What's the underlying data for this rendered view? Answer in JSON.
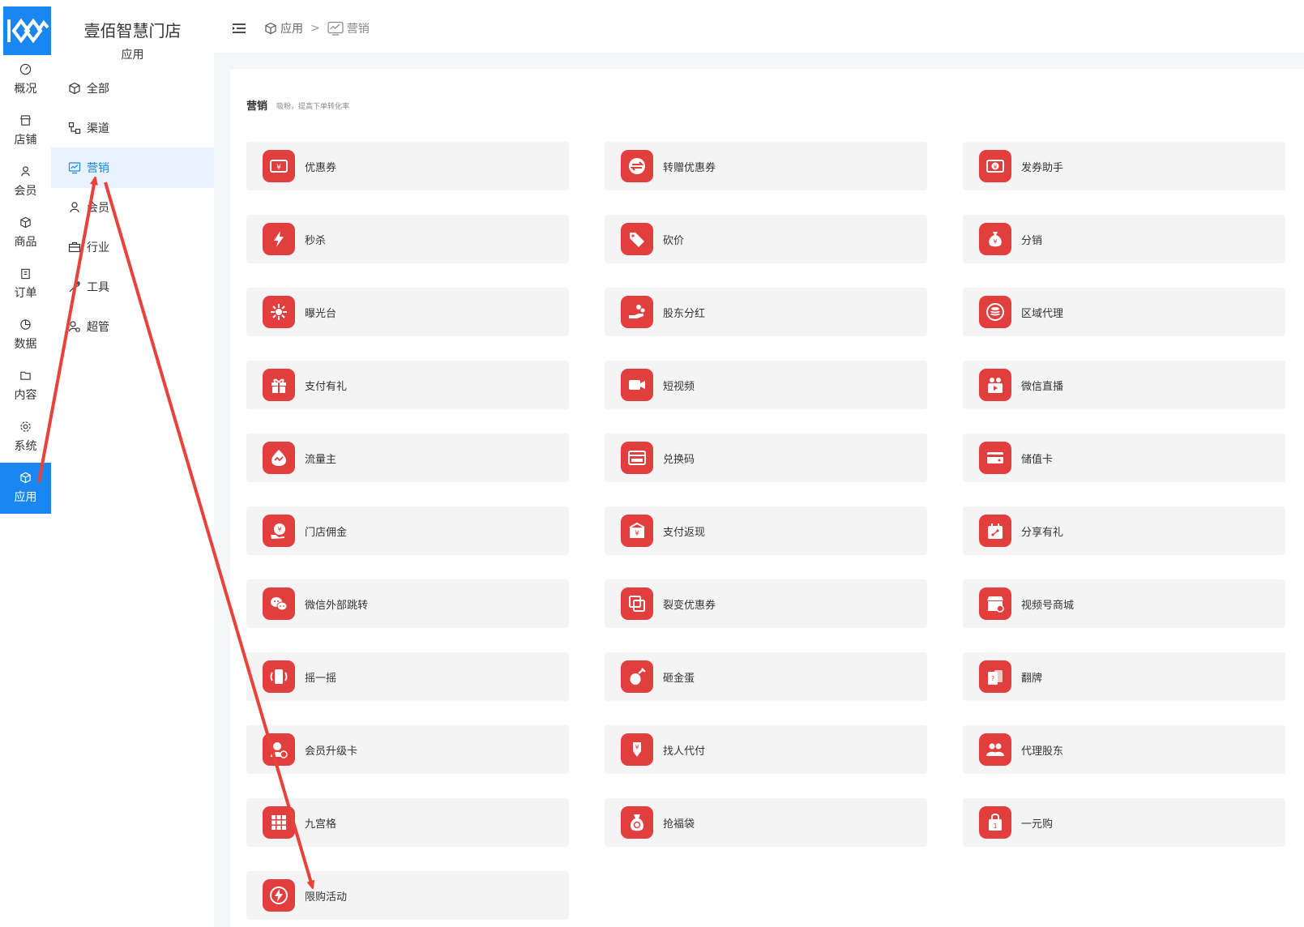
{
  "store_name": "壹佰智慧门店",
  "rail": [
    {
      "label": "概况",
      "icon": "gauge-icon"
    },
    {
      "label": "店铺",
      "icon": "shop-icon"
    },
    {
      "label": "会员",
      "icon": "user-icon"
    },
    {
      "label": "商品",
      "icon": "box-icon"
    },
    {
      "label": "订单",
      "icon": "clipboard-icon"
    },
    {
      "label": "数据",
      "icon": "pie-icon"
    },
    {
      "label": "内容",
      "icon": "folder-icon"
    },
    {
      "label": "系统",
      "icon": "gear-icon"
    },
    {
      "label": "应用",
      "icon": "cube-icon",
      "active": true
    }
  ],
  "submenu": {
    "title": "应用",
    "items": [
      {
        "label": "全部",
        "icon": "cube-icon"
      },
      {
        "label": "渠道",
        "icon": "channel-icon"
      },
      {
        "label": "营销",
        "icon": "chart-monitor-icon",
        "active": true
      },
      {
        "label": "会员",
        "icon": "user-icon"
      },
      {
        "label": "行业",
        "icon": "briefcase-icon"
      },
      {
        "label": "工具",
        "icon": "tool-icon"
      },
      {
        "label": "超管",
        "icon": "admin-icon"
      }
    ]
  },
  "breadcrumb": [
    {
      "label": "应用",
      "icon": "cube-icon"
    },
    {
      "label": "营销",
      "icon": "chart-monitor-icon"
    }
  ],
  "breadcrumb_separator": ">",
  "section": {
    "title": "营销",
    "desc": "吸粉，提高下单转化率"
  },
  "accent_color": "#1a86f0",
  "card_icon_color": "#e23e3e",
  "cards": [
    {
      "label": "优惠券",
      "icon": "coupon-icon"
    },
    {
      "label": "转赠优惠券",
      "icon": "transfer-icon"
    },
    {
      "label": "发券助手",
      "icon": "coupon-assistant-icon"
    },
    {
      "label": "秒杀",
      "icon": "lightning-icon"
    },
    {
      "label": "砍价",
      "icon": "price-tag-icon"
    },
    {
      "label": "分销",
      "icon": "money-bag-icon"
    },
    {
      "label": "曝光台",
      "icon": "sparkle-icon"
    },
    {
      "label": "股东分红",
      "icon": "hand-coins-icon"
    },
    {
      "label": "区域代理",
      "icon": "coins-stack-icon"
    },
    {
      "label": "支付有礼",
      "icon": "gift-icon"
    },
    {
      "label": "短视频",
      "icon": "video-camera-icon"
    },
    {
      "label": "微信直播",
      "icon": "live-icon"
    },
    {
      "label": "流量主",
      "icon": "traffic-icon"
    },
    {
      "label": "兑换码",
      "icon": "redeem-code-icon"
    },
    {
      "label": "储值卡",
      "icon": "card-icon"
    },
    {
      "label": "门店佣金",
      "icon": "commission-icon"
    },
    {
      "label": "支付返现",
      "icon": "cashback-icon"
    },
    {
      "label": "分享有礼",
      "icon": "share-gift-icon"
    },
    {
      "label": "微信外部跳转",
      "icon": "wechat-icon"
    },
    {
      "label": "裂变优惠券",
      "icon": "fission-coupon-icon"
    },
    {
      "label": "视频号商城",
      "icon": "video-shop-icon"
    },
    {
      "label": "摇一摇",
      "icon": "shake-icon"
    },
    {
      "label": "砸金蛋",
      "icon": "egg-hammer-icon"
    },
    {
      "label": "翻牌",
      "icon": "flip-card-icon"
    },
    {
      "label": "会员升级卡",
      "icon": "member-upgrade-icon"
    },
    {
      "label": "找人代付",
      "icon": "pay-for-me-icon"
    },
    {
      "label": "代理股东",
      "icon": "agent-shareholder-icon"
    },
    {
      "label": "九宫格",
      "icon": "grid-icon"
    },
    {
      "label": "抢福袋",
      "icon": "lucky-bag-icon"
    },
    {
      "label": "一元购",
      "icon": "one-yuan-bag-icon"
    },
    {
      "label": "限购活动",
      "icon": "limit-flash-icon"
    }
  ]
}
